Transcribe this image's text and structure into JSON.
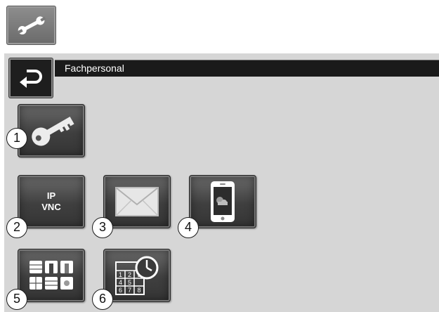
{
  "header": {
    "title": "Fachpersonal"
  },
  "toolbar": {
    "tool_icon": "wrench-icon",
    "back_icon": "back-arrow-icon"
  },
  "tiles": [
    {
      "number": "1",
      "icon": "key-icon"
    },
    {
      "number": "2",
      "icon": "ip-vnc-icon",
      "line1": "IP",
      "line2": "VNC"
    },
    {
      "number": "3",
      "icon": "envelope-icon"
    },
    {
      "number": "4",
      "icon": "smartphone-icon"
    },
    {
      "number": "5",
      "icon": "module-grid-icon"
    },
    {
      "number": "6",
      "icon": "calendar-clock-icon",
      "cal": [
        "1",
        "2",
        "3",
        "4",
        "5",
        "6",
        "7",
        "8"
      ]
    }
  ],
  "colors": {
    "panel": "#d6d6d6",
    "title_bar": "#1a1a1a",
    "tile_dark": "#3f3f3f"
  }
}
